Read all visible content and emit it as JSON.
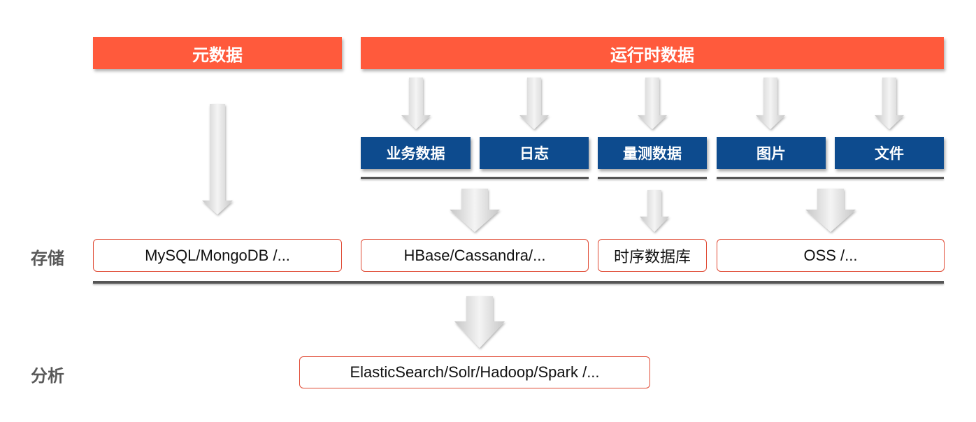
{
  "headers": {
    "metadata": "元数据",
    "runtime": "运行时数据"
  },
  "categories": [
    "业务数据",
    "日志",
    "量测数据",
    "图片",
    "文件"
  ],
  "row_labels": {
    "storage": "存储",
    "analysis": "分析"
  },
  "storage": {
    "metadata": "MySQL/MongoDB /...",
    "hbase": "HBase/Cassandra/...",
    "tsdb": "时序数据库",
    "oss": "OSS /..."
  },
  "analysis": "ElasticSearch/Solr/Hadoop/Spark /...",
  "colors": {
    "header": "#ff5a3c",
    "category": "#0d4b8e",
    "box_border": "#e04a34",
    "line": "#555555"
  }
}
